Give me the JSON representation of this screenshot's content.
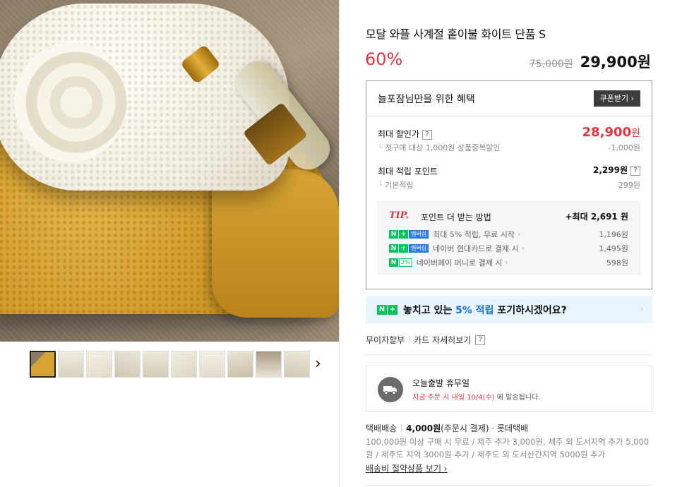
{
  "product": {
    "title": "모달 와플 사계절 홑이불 화이트 단품 S",
    "discount_rate": "60%",
    "original_price": "75,000원",
    "sale_price": "29,900원"
  },
  "gallery": {
    "thumbnail_count": 10,
    "selected_index": 0,
    "next_icon": "chevron-right-icon",
    "next_glyph": "›"
  },
  "benefits": {
    "title": "늘포잠님만을 위한 혜택",
    "coupon_button": "쿠폰받기 ›",
    "max_discount": {
      "label": "최대 할인가",
      "help": "?",
      "price": "28,900",
      "price_unit": "원",
      "sub_label": "첫구매 대상 1,000원 상품중복할인",
      "sub_value": "-1,000원"
    },
    "max_points": {
      "label": "최대 적립 포인트",
      "value": "2,299원",
      "help": "?",
      "sub_label": "기본적립",
      "sub_value": "299원"
    },
    "tip": {
      "mark": "TIP.",
      "title": "포인트 더 받는 방법",
      "max": "+최대 2,691 원",
      "rows": [
        {
          "badge": "멤버십",
          "text": "최대 5% 적립, 무료 시작",
          "amount": "1,196원"
        },
        {
          "badge": "멤버십",
          "text": "네이버 현대카드로 결제 시",
          "amount": "1,495원"
        },
        {
          "badge": "2%",
          "text": "네이버페이 머니로 결제 시",
          "amount": "598원"
        }
      ]
    }
  },
  "promo": {
    "text_before": "놓치고 있는 ",
    "highlight": "5% 적립",
    "text_after": " 포기하시겠어요?",
    "arrow": "›"
  },
  "card_links": {
    "installment": "무이자할부",
    "card_details": "카드 자세히보기",
    "help": "?"
  },
  "shipping": {
    "title": "오늘출발 휴무일",
    "sub_before": "지금 주문 시 내일 ",
    "sub_date": "10/4(수)",
    "sub_after": " 에 발송됩니다.",
    "icon": "truck-icon"
  },
  "delivery": {
    "method": "택배배송",
    "fee": "4,000원",
    "fee_note": "(주문시 결제) · 롯데택배",
    "note": "100,000원 이상 구매 시 무료 / 제주 추가 3,000원, 제주 외 도서지역 추가 5,000원 / 제주도 지역 3000원 추가 / 제주도 외 도서산간지역 5000원 추가",
    "save_link": "배송비 절약상품 보기 ›"
  },
  "colors": {
    "accent_red": "#e4353f",
    "naver_green": "#03c75a",
    "promo_blue": "#1d6fe0"
  }
}
